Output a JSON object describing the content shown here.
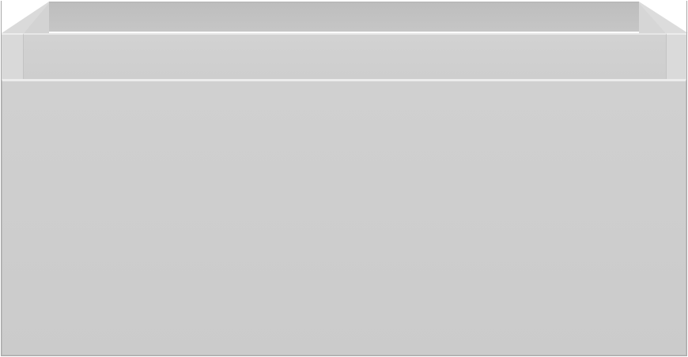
{
  "scene": {
    "subject": "open-top-box",
    "colors": {
      "panel": "#cdcdcd",
      "inner_wall": "#c2c2c2",
      "highlight": "#ececec",
      "edge": "#bdbdbd"
    }
  }
}
